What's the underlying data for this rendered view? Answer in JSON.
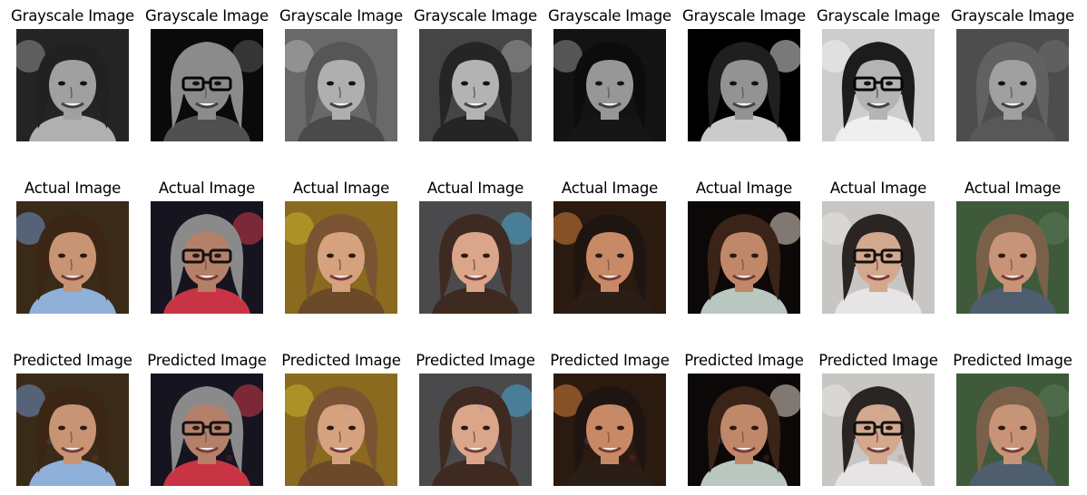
{
  "figure": {
    "rows": [
      {
        "key": "grayscale",
        "title": "Grayscale Image",
        "grayscale": true
      },
      {
        "key": "actual",
        "title": "Actual Image",
        "grayscale": false
      },
      {
        "key": "predicted",
        "title": "Predicted Image",
        "grayscale": false
      }
    ],
    "subjects": [
      {
        "desc": "young person with tousled brown hair, smiling",
        "bg": "#3a2a18",
        "accent": "#6b8fc7",
        "hair": "#3b2616",
        "skin": "#c99474",
        "shirt": "#8fb0d8",
        "glasses": false
      },
      {
        "desc": "older man with gray hair and glasses",
        "bg": "#15141f",
        "accent": "#d23a4a",
        "hair": "#8a8a8a",
        "skin": "#b5806a",
        "shirt": "#c83444",
        "glasses": true
      },
      {
        "desc": "woman with long light brown hair, smiling",
        "bg": "#8a6a1e",
        "accent": "#c8b030",
        "hair": "#7a5432",
        "skin": "#d6a27e",
        "shirt": "#6b4a2a",
        "glasses": false
      },
      {
        "desc": "woman with long dark brown hair, smiling",
        "bg": "#4a4a4c",
        "accent": "#49a9d9",
        "hair": "#3e2a20",
        "skin": "#dba58a",
        "shirt": "#3e2a20",
        "glasses": false
      },
      {
        "desc": "woman with dark hair and earrings, smiling",
        "bg": "#2a1a10",
        "accent": "#d2803a",
        "hair": "#1f1510",
        "skin": "#c88a66",
        "shirt": "#2a1e16",
        "glasses": false
      },
      {
        "desc": "woman with dark hair, looking sideways",
        "bg": "#0c0808",
        "accent": "#e0d6c8",
        "hair": "#3a2418",
        "skin": "#c08868",
        "shirt": "#b8c8c0",
        "glasses": false
      },
      {
        "desc": "man with short dark hair and glasses",
        "bg": "#c8c6c2",
        "accent": "#e8e6e2",
        "hair": "#2a2422",
        "skin": "#d4a88e",
        "shirt": "#e6e4e4",
        "glasses": true
      },
      {
        "desc": "man with brown hair, neutral expression",
        "bg": "#3e5a3a",
        "accent": "#5a7a5a",
        "hair": "#7a6048",
        "skin": "#c89478",
        "shirt": "#4e5e6e",
        "glasses": false
      }
    ]
  }
}
